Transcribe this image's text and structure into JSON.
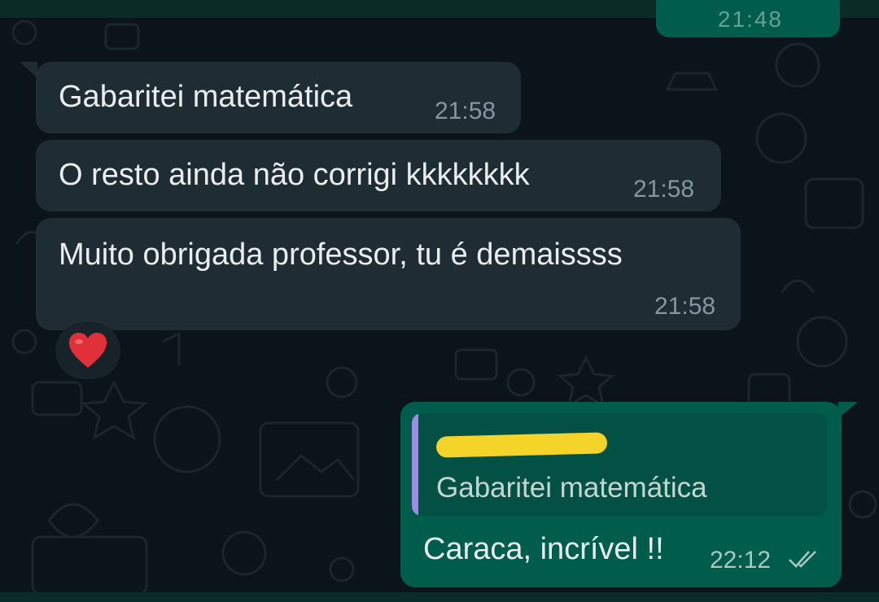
{
  "previous_message": {
    "time": "21:48"
  },
  "incoming_messages": [
    {
      "text": "Gabaritei matemática",
      "time": "21:58"
    },
    {
      "text": "O resto ainda não corrigi kkkkkkkk",
      "time": "21:58"
    },
    {
      "text": "Muito obrigada professor, tu é demaissss",
      "time": "21:58"
    }
  ],
  "reaction": {
    "icon": "red-heart-icon",
    "color": "#e0303a"
  },
  "outgoing_message": {
    "quoted_text": "Gabaritei matemática",
    "text": "Caraca, incrível !!",
    "time": "22:12",
    "status_icon": "double-check-icon"
  },
  "colors": {
    "background": "#0b141a",
    "incoming_bubble": "#202c33",
    "outgoing_bubble": "#005c4b",
    "quote_bar": "#a189e8"
  }
}
